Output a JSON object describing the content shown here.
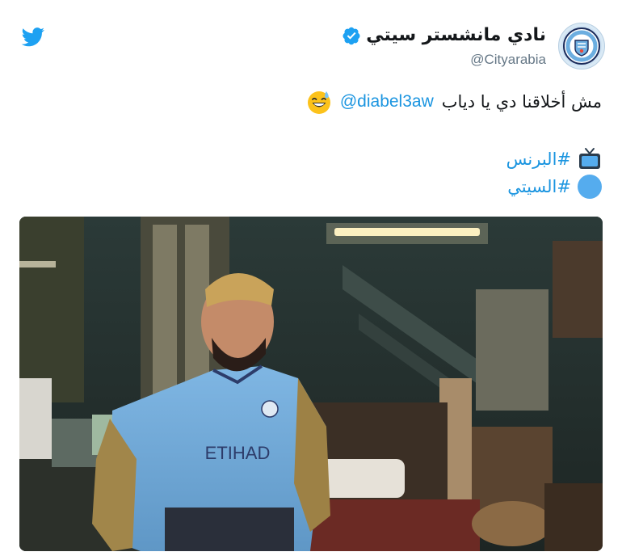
{
  "account": {
    "display_name": "نادي مانشستر سيتي",
    "handle": "@Cityarabia",
    "verified": true,
    "avatar_icon": "manchester-city-crest-icon"
  },
  "brand": {
    "logo_icon": "twitter-bird-icon",
    "accent_color": "#1da1f2",
    "link_color": "#1b95e0"
  },
  "tweet": {
    "text": "مش أخلاقنا دي يا دياب",
    "mention": "@diabel3aw",
    "text_emoji": "grinning-face-with-sweat-icon",
    "hashtags": [
      {
        "text": "#البرنس",
        "emoji": "tv-icon"
      },
      {
        "text": "#السيتي",
        "emoji": "blue-circle-icon"
      }
    ]
  },
  "media": {
    "type": "image",
    "jersey_text": "ETIHAD"
  }
}
